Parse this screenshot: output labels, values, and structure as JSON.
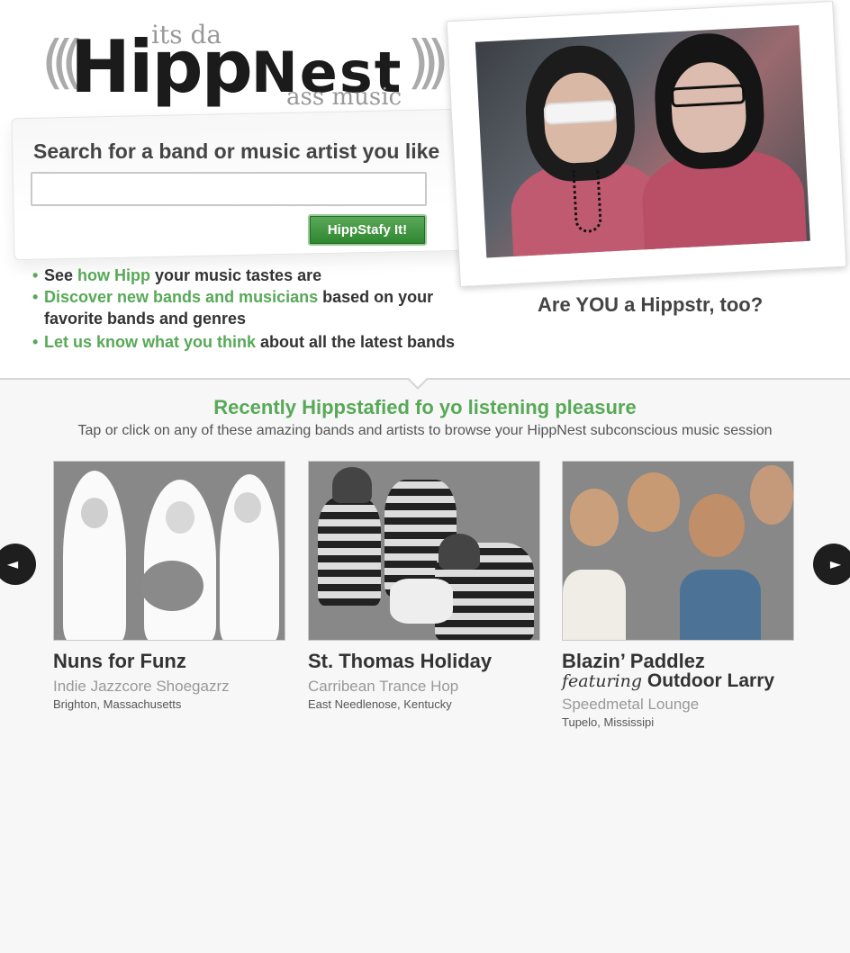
{
  "logo": {
    "tag_top": "its da",
    "brand_hipp": "Hipp",
    "brand_nest": "Nest",
    "tag_bottom": "ass music"
  },
  "search": {
    "label": "Search for a band or music artist you like",
    "value": "",
    "placeholder": "",
    "button_label": "HippStafy It!"
  },
  "bullets": [
    {
      "pre": "See ",
      "link": "how Hipp",
      "post": " your music tastes are"
    },
    {
      "pre": "",
      "link": "Discover new bands and musicians",
      "post": " based on your favorite bands and genres"
    },
    {
      "pre": "",
      "link": "Let us know what you think",
      "post": " about all the  latest bands"
    }
  ],
  "hero": {
    "caption": "Are YOU a Hippstr, too?"
  },
  "recent": {
    "title": "Recently Hippstafied fo yo listening pleasure",
    "subtitle": "Tap or click on any of these amazing bands and artists to browse your HippNest subconscious music session"
  },
  "bands": [
    {
      "name": "Nuns for Funz",
      "genre": "Indie Jazzcore Shoegazrz",
      "location": "Brighton, Massachusetts"
    },
    {
      "name": "St. Thomas Holiday",
      "genre": "Carribean Trance Hop",
      "location": "East Needlenose, Kentucky"
    },
    {
      "name": "Blazin’ Paddlez",
      "featuring_word": "featuring",
      "featuring_name": "Outdoor Larry",
      "genre": "Speedmetal Lounge",
      "location": "Tupelo, Mississipi"
    }
  ],
  "carousel": {
    "prev_icon": "◄",
    "next_icon": "►"
  },
  "colors": {
    "accent_green": "#57a957",
    "text_dark": "#333333",
    "text_muted": "#999999"
  }
}
